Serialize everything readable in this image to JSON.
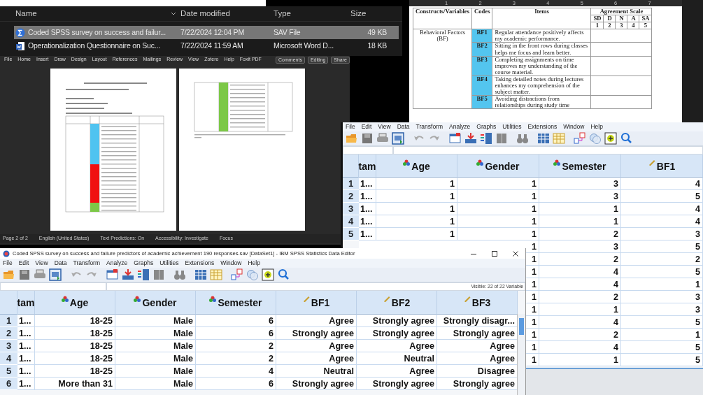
{
  "explorer": {
    "columns": [
      "Name",
      "Date modified",
      "Type",
      "Size"
    ],
    "files": [
      {
        "kind": "sav",
        "name": "Coded SPSS survey on success and failur...",
        "date": "7/22/2024 12:04 PM",
        "type": "SAV File",
        "size": "49 KB",
        "selected": true
      },
      {
        "kind": "docx",
        "name": "Operationalization Questionnaire on Suc...",
        "date": "7/22/2024 11:59 AM",
        "type": "Microsoft Word D...",
        "size": "18 KB",
        "selected": false
      }
    ]
  },
  "word": {
    "ribbon_tabs": [
      "File",
      "Home",
      "Insert",
      "Draw",
      "Design",
      "Layout",
      "References",
      "Mailings",
      "Review",
      "View",
      "Zotero",
      "Help",
      "Foxit PDF"
    ],
    "buttons": [
      "Comments",
      "Editing",
      "Share"
    ],
    "status_bar": [
      "Page 2 of 2",
      "English (United States)",
      "Text Predictions: On",
      "Accessibility: Investigate",
      "Focus"
    ]
  },
  "document_table": {
    "ruler_numbers": [
      "1",
      "2",
      "3",
      "4",
      "5",
      "6",
      "7"
    ],
    "columns": [
      "Constructs/Variables",
      "Codes",
      "Items",
      "Agreement Scale"
    ],
    "scale_labels": [
      "SD",
      "D",
      "N",
      "A",
      "SA"
    ],
    "scale_values": [
      "1",
      "2",
      "3",
      "4",
      "5"
    ],
    "construct": "Behavioral Factors (BF)",
    "rows": [
      {
        "code": "BF1",
        "item": "Regular attendance positively affects my academic performance."
      },
      {
        "code": "BF2",
        "item": "Sitting in the front rows during classes helps me focus and learn better."
      },
      {
        "code": "BF3",
        "item": "Completing assignments on time improves my understanding of the course material."
      },
      {
        "code": "BF4",
        "item": "Taking detailed notes during lectures enhances my comprehension of the subject matter."
      },
      {
        "code": "BF5",
        "item": "Avoiding distractions from relationships during study time"
      }
    ]
  },
  "spss_numeric": {
    "menu": [
      "File",
      "Edit",
      "View",
      "Data",
      "Transform",
      "Analyze",
      "Graphs",
      "Utilities",
      "Extensions",
      "Window",
      "Help"
    ],
    "columns": [
      {
        "label": "tam"
      },
      {
        "label": "Age",
        "kind": "nominal"
      },
      {
        "label": "Gender",
        "kind": "nominal"
      },
      {
        "label": "Semester",
        "kind": "nominal"
      },
      {
        "label": "BF1",
        "kind": "scale"
      }
    ],
    "rows": [
      {
        "row": "1",
        "cells": [
          "1...",
          "1",
          "1",
          "3",
          "4"
        ]
      },
      {
        "row": "2",
        "cells": [
          "1...",
          "1",
          "1",
          "3",
          "5"
        ]
      },
      {
        "row": "3",
        "cells": [
          "1...",
          "1",
          "1",
          "1",
          "4"
        ]
      },
      {
        "row": "4",
        "cells": [
          "1...",
          "1",
          "1",
          "1",
          "4"
        ]
      },
      {
        "row": "5",
        "cells": [
          "1...",
          "1",
          "1",
          "2",
          "3"
        ]
      },
      {
        "cells": [
          "1",
          "3",
          "5"
        ]
      },
      {
        "cells": [
          "1",
          "2",
          "2"
        ]
      },
      {
        "cells": [
          "1",
          "4",
          "5"
        ]
      },
      {
        "cells": [
          "1",
          "4",
          "1"
        ]
      },
      {
        "cells": [
          "1",
          "2",
          "3"
        ]
      },
      {
        "cells": [
          "1",
          "1",
          "3"
        ]
      },
      {
        "cells": [
          "1",
          "4",
          "5"
        ]
      },
      {
        "cells": [
          "1",
          "2",
          "1"
        ]
      },
      {
        "cells": [
          "1",
          "4",
          "5"
        ]
      },
      {
        "cells": [
          "1",
          "1",
          "5"
        ]
      }
    ]
  },
  "spss_labeled": {
    "title": "Coded SPSS survey on success and failure predictors of academic achievement 190 responses.sav [DataSet1] - IBM SPSS Statistics Data Editor",
    "menu": [
      "File",
      "Edit",
      "View",
      "Data",
      "Transform",
      "Analyze",
      "Graphs",
      "Utilities",
      "Extensions",
      "Window",
      "Help"
    ],
    "visible": "Visible: 22 of 22 Variable",
    "columns": [
      {
        "label": "tam"
      },
      {
        "label": "Age",
        "kind": "nominal"
      },
      {
        "label": "Gender",
        "kind": "nominal"
      },
      {
        "label": "Semester",
        "kind": "nominal"
      },
      {
        "label": "BF1",
        "kind": "scale"
      },
      {
        "label": "BF2",
        "kind": "scale"
      },
      {
        "label": "BF3",
        "kind": "scale"
      }
    ],
    "rows": [
      {
        "row": "1",
        "cells": [
          "1...",
          "18-25",
          "Male",
          "6",
          "Agree",
          "Strongly agree",
          "Strongly disagr..."
        ]
      },
      {
        "row": "2",
        "cells": [
          "1...",
          "18-25",
          "Male",
          "6",
          "Strongly agree",
          "Strongly agree",
          "Strongly agree"
        ]
      },
      {
        "row": "3",
        "cells": [
          "1...",
          "18-25",
          "Male",
          "2",
          "Agree",
          "Agree",
          "Agree"
        ]
      },
      {
        "row": "4",
        "cells": [
          "1...",
          "18-25",
          "Male",
          "2",
          "Agree",
          "Neutral",
          "Agree"
        ]
      },
      {
        "row": "5",
        "cells": [
          "1...",
          "18-25",
          "Male",
          "4",
          "Neutral",
          "Agree",
          "Disagree"
        ]
      },
      {
        "row": "6",
        "cells": [
          "1...",
          "More than 31",
          "Male",
          "6",
          "Strongly agree",
          "Strongly agree",
          "Strongly agree"
        ]
      }
    ]
  }
}
